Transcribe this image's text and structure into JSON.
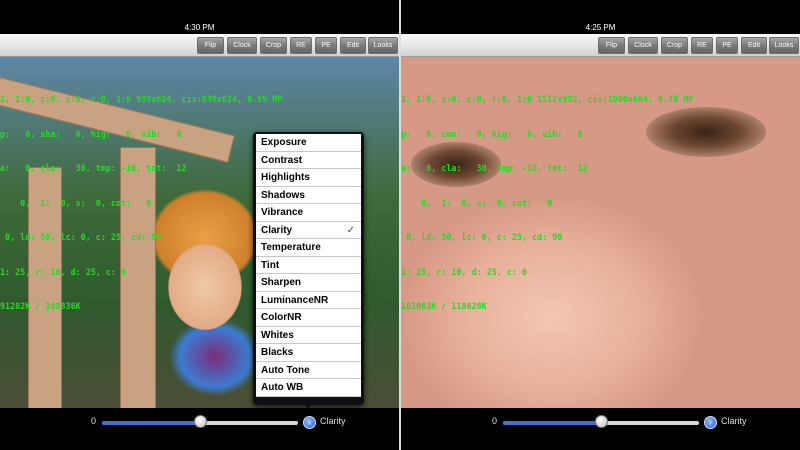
{
  "left": {
    "time": "4:30 PM",
    "toolbar": [
      "Flip",
      "Clock",
      "Crop",
      "RE",
      "PE",
      "Edit",
      "Looks"
    ],
    "overlay": [
      "1, 1:0, c:0, c:0, r:0, 1:0 939x624, cis:939x624, 0.59 MP",
      "p:   0, sha:   0, hig:   0, vib:   0",
      "a:   0, cla:   30, tmp: -10, tnt:  12",
      "    0,  1:  0, s:  0, cot:   0",
      " 0, ld: 50, lc: 0, c: 25, cd: 90",
      "1: 25, r: 10, d: 25, c: 0",
      "91282K / 108836K"
    ],
    "menu": {
      "items": [
        "Exposure",
        "Contrast",
        "Highlights",
        "Shadows",
        "Vibrance",
        "Clarity",
        "Temperature",
        "Tint",
        "Sharpen",
        "LuminanceNR",
        "ColorNR",
        "Whites",
        "Blacks",
        "Auto Tone",
        "Auto WB"
      ],
      "selected": "Clarity",
      "check_glyph": "✓"
    },
    "slider": {
      "min_label": "0",
      "fraction": 0.5,
      "param": "Clarity"
    }
  },
  "right": {
    "time": "4:25 PM",
    "toolbar": [
      "Flip",
      "Clock",
      "Crop",
      "RE",
      "PE",
      "Edit",
      "Looks"
    ],
    "overlay": [
      "1, 1:0, c:0, c:0, r:0, 1:0 1512x992, cis:1000x664, 0.78 MP",
      "p:   0, con:   0, hig:   0, vib:   0",
      "a:   0, cla:   30, tmp: -10, tnt:  12",
      "    0,  1:  0, s:  0, cot:   0",
      " 0, ld: 50, lc: 0, c: 25, cd: 90",
      "1: 25, r: 10, d: 25, c: 0",
      "101063K / 118628K"
    ],
    "slider": {
      "min_label": "0",
      "fraction": 0.5,
      "param": "Clarity"
    }
  },
  "icons": {
    "param_button": "chevron-right-circle-icon"
  },
  "colors": {
    "overlay_text": "#29d829",
    "slider_fill": "#3d73cf",
    "param_button": "#2a64c9"
  }
}
